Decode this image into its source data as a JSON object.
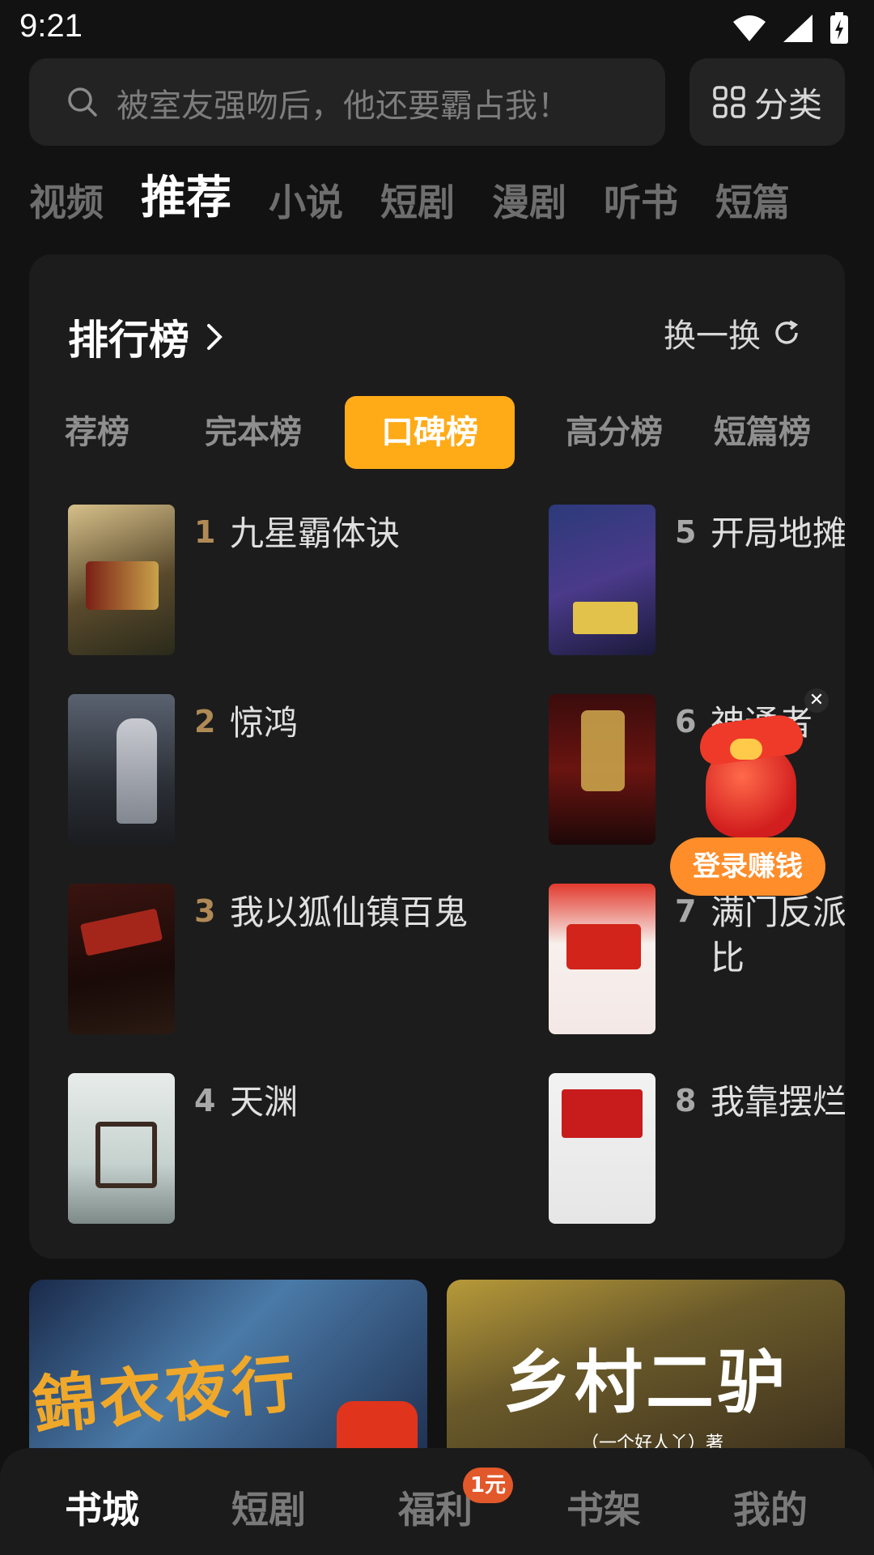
{
  "status": {
    "time": "9:21"
  },
  "search": {
    "placeholder": "被室友强吻后，他还要霸占我！",
    "category_label": "分类"
  },
  "top_tabs": [
    {
      "label": "视频",
      "active": false
    },
    {
      "label": "推荐",
      "active": true
    },
    {
      "label": "小说",
      "active": false
    },
    {
      "label": "短剧",
      "active": false
    },
    {
      "label": "漫剧",
      "active": false
    },
    {
      "label": "听书",
      "active": false
    },
    {
      "label": "短篇",
      "active": false
    }
  ],
  "rank": {
    "title": "排行榜",
    "refresh_label": "换一换",
    "tabs": [
      "荐榜",
      "完本榜",
      "口碑榜",
      "高分榜",
      "短篇榜"
    ],
    "active_tab": "口碑榜",
    "books": [
      {
        "rank": "1",
        "name": "九星霸体诀"
      },
      {
        "rank": "2",
        "name": "惊鸿"
      },
      {
        "rank": "3",
        "name": "我以狐仙镇百鬼"
      },
      {
        "rank": "4",
        "name": "天渊"
      },
      {
        "rank": "5",
        "name": "开局地摊卖大力"
      },
      {
        "rank": "6",
        "name": "神通者"
      },
      {
        "rank": "7",
        "name": "满门反派疯批，唯有师妹逗比"
      },
      {
        "rank": "8",
        "name": "我靠摆烂拯救了全宗门"
      }
    ]
  },
  "float_ad": {
    "label": "登录赚钱"
  },
  "promos": [
    {
      "title": "錦衣夜行"
    },
    {
      "title": "乡村二驴",
      "author": "（一个好人丫）著"
    }
  ],
  "bottom_nav": [
    {
      "label": "书城",
      "active": true
    },
    {
      "label": "短剧",
      "active": false
    },
    {
      "label": "福利",
      "active": false,
      "badge": "1元"
    },
    {
      "label": "书架",
      "active": false
    },
    {
      "label": "我的",
      "active": false
    }
  ],
  "colors": {
    "accent": "#ffab17",
    "background": "#121212",
    "card": "#1c1c1c",
    "rank_number": "#b08a56"
  }
}
